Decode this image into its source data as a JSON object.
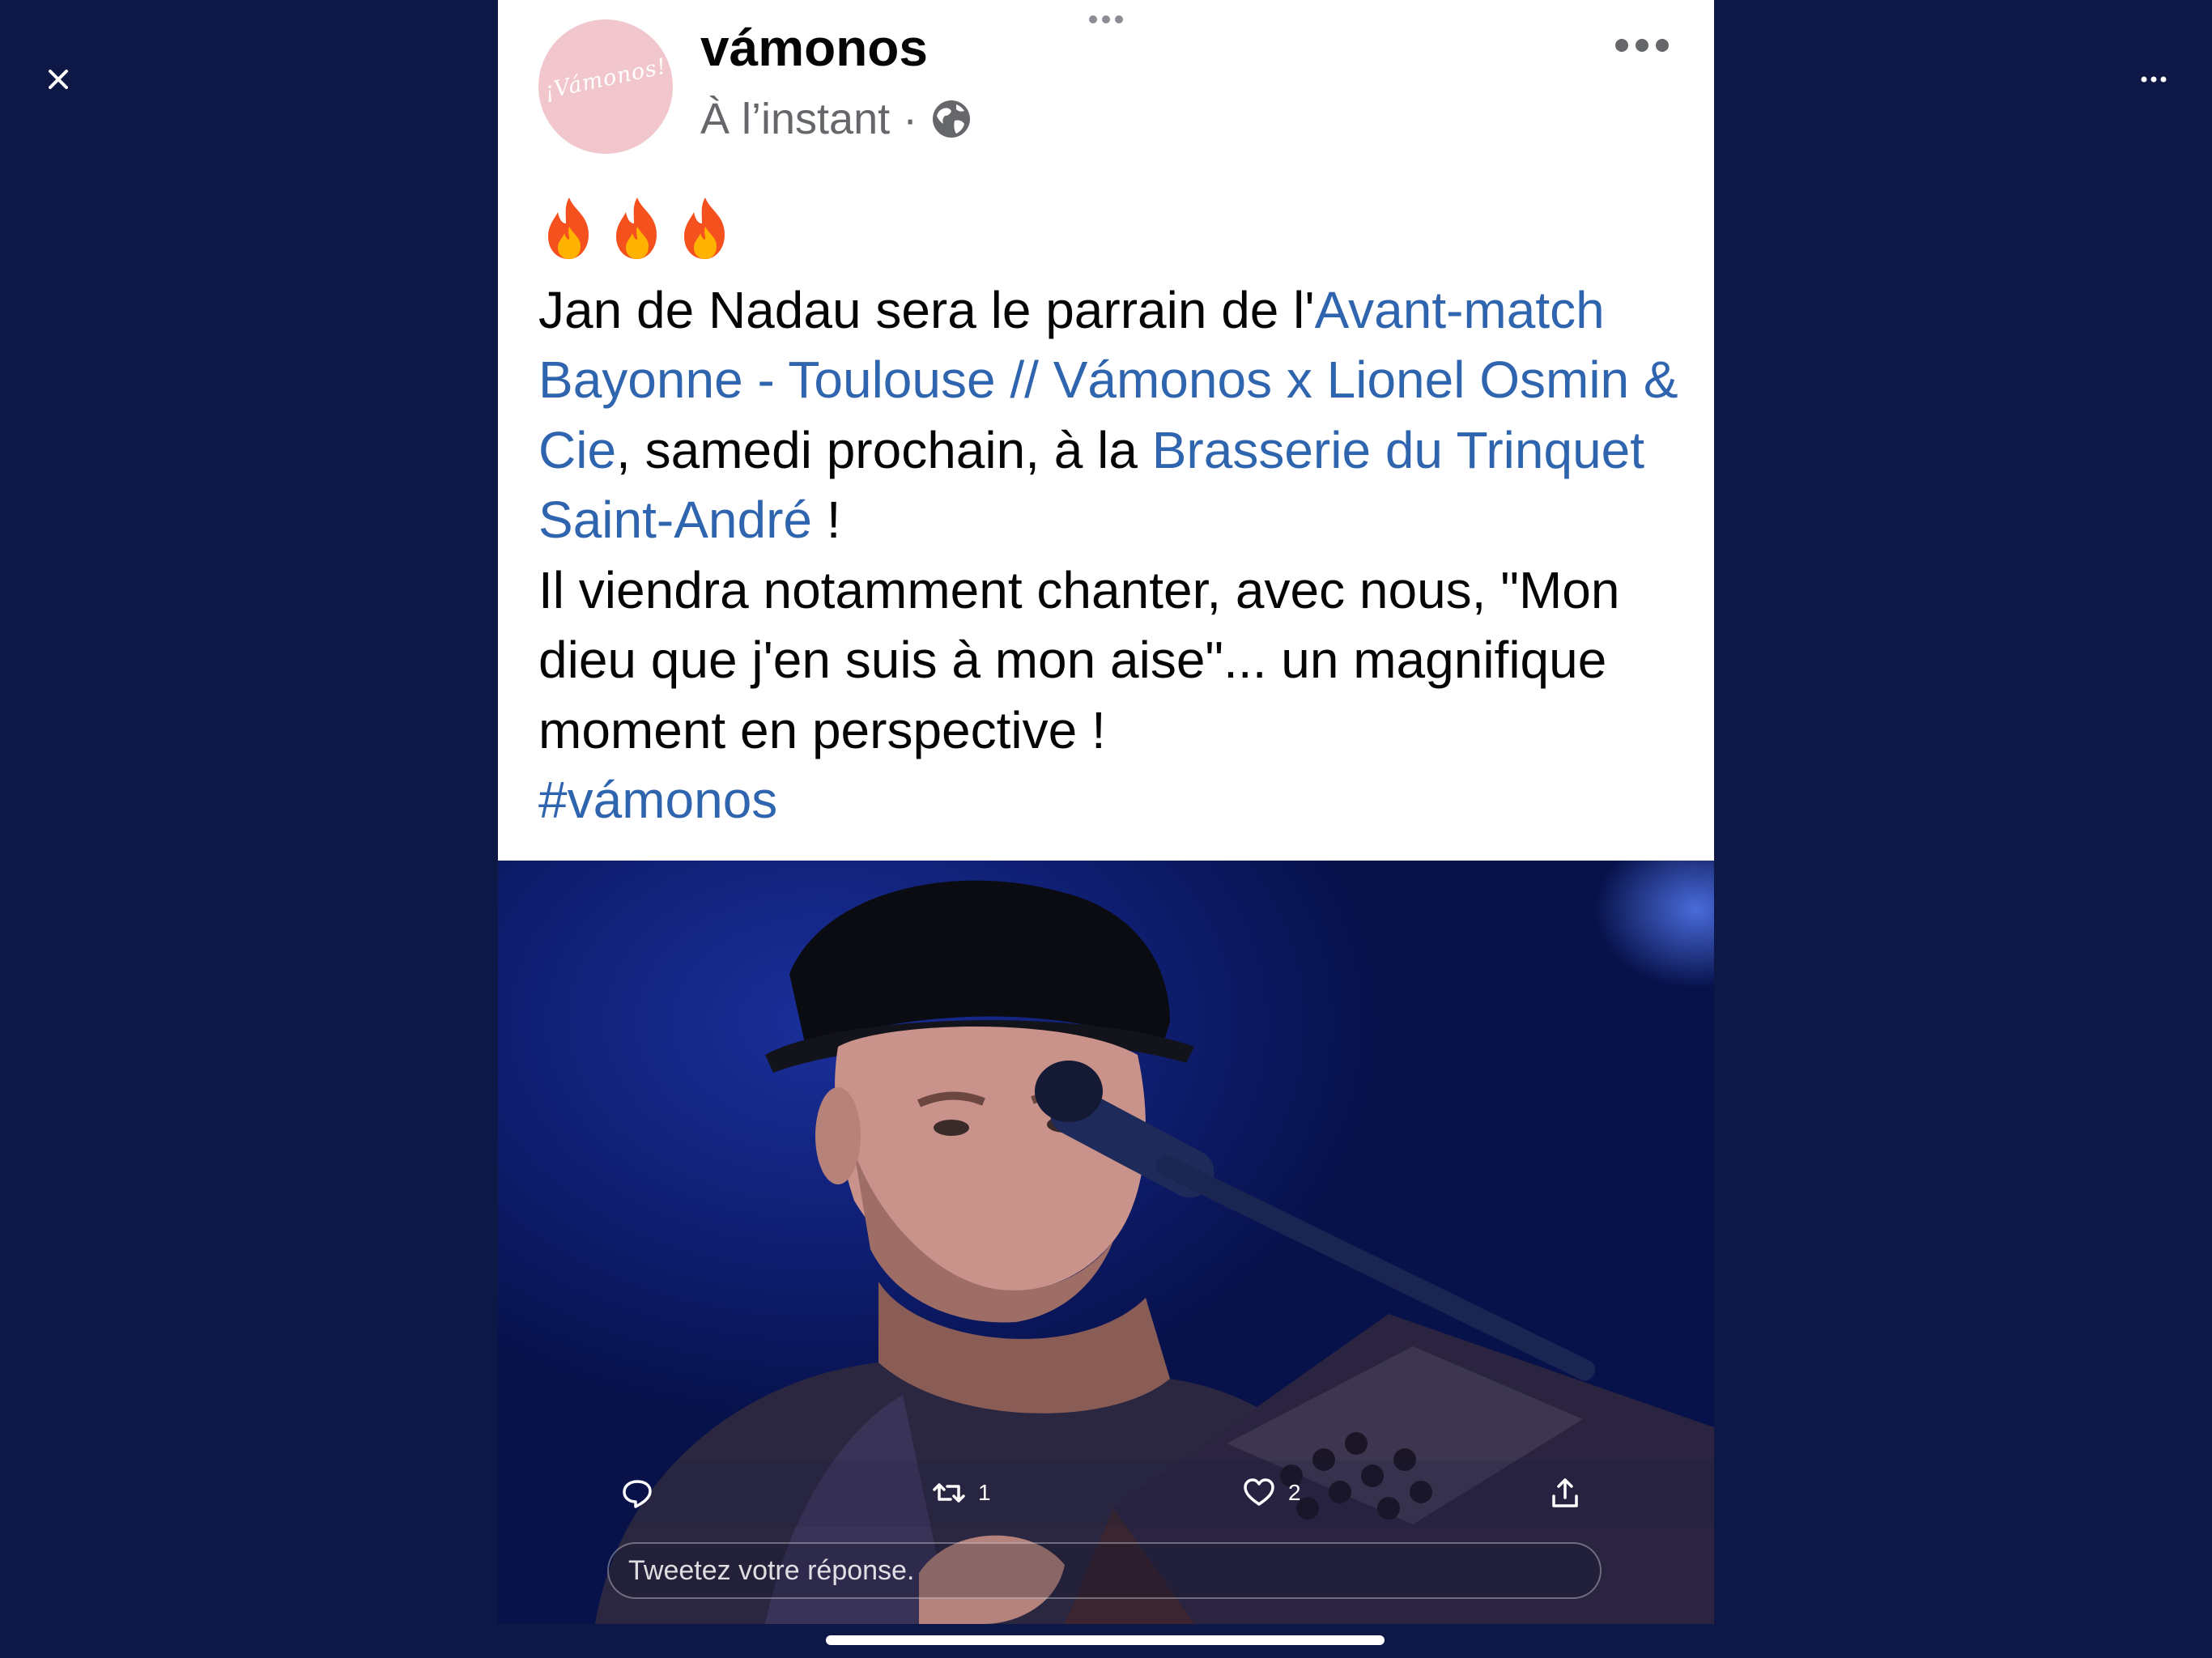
{
  "post": {
    "author": "vámonos",
    "timestamp": "À l’instant",
    "separator": "·",
    "avatar_text": "¡Vámonos!",
    "emojis": [
      "🔥",
      "🔥",
      "🔥"
    ],
    "body": {
      "t1": "Jan de Nadau sera le parrain de l'",
      "link1": "Avant-match Bayonne - Toulouse // Vámonos x Lionel Osmin & Cie",
      "t2": ", samedi prochain, à la ",
      "link2": "Brasserie du Trinquet Saint-André",
      "t3": " !",
      "t4": "Il viendra notamment chanter, avec nous, \"Mon dieu que j'en suis à mon aise\"... un magnifique moment en perspective !",
      "hashtag": "#vámonos"
    }
  },
  "actions": {
    "retweet_count": "1",
    "like_count": "2"
  },
  "reply": {
    "placeholder": "Tweetez votre réponse."
  },
  "colors": {
    "background": "#0d1846",
    "link": "#2f64ae",
    "meta": "#65676b",
    "avatar_bg": "#f1c6cc"
  },
  "icons": {
    "close": "close-icon",
    "more": "more-horizontal-icon",
    "reply": "reply-bubble-icon",
    "retweet": "retweet-icon",
    "like": "heart-icon",
    "share": "share-upload-icon",
    "globe": "globe-icon"
  }
}
